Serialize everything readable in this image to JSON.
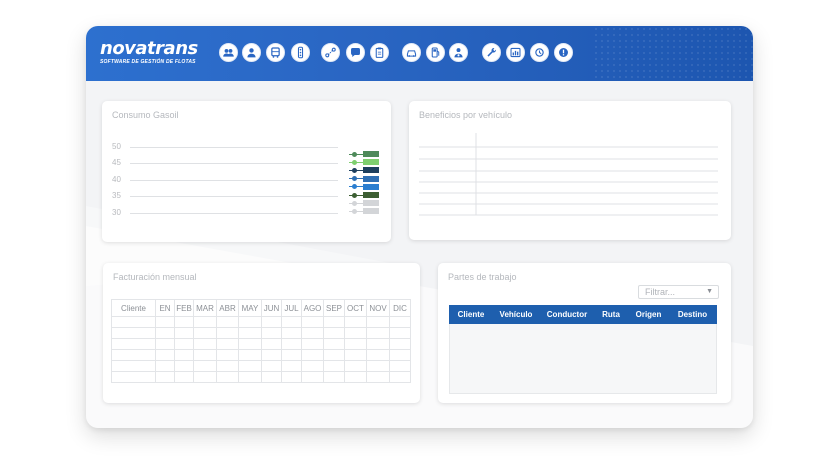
{
  "logo": {
    "name": "novatrans",
    "tagline": "SOFTWARE DE GESTIÓN DE FLOTAS"
  },
  "toolbar": {
    "icons": [
      "users-icon",
      "user-icon",
      "bus-icon",
      "traffic-light-icon",
      "route-icon",
      "chat-icon",
      "clipboard-icon",
      "car-icon",
      "fuel-icon",
      "driver-icon",
      "wrench-icon",
      "report-icon",
      "service-icon",
      "alert-icon"
    ]
  },
  "consumo": {
    "title": "Consumo Gasoil",
    "yticks": [
      "50",
      "45",
      "40",
      "35",
      "30"
    ],
    "legend_colors": [
      "#4e8a5a",
      "#7fcf6f",
      "#1d3f5e",
      "#2f6fb3",
      "#2b7ed0",
      "#3d5f33",
      "#d3d5d8",
      "#d3d5d8"
    ]
  },
  "beneficios": {
    "title": "Beneficios por vehículo"
  },
  "facturacion": {
    "title": "Facturación mensual",
    "columns": [
      "Cliente",
      "EN",
      "FEB",
      "MAR",
      "ABR",
      "MAY",
      "JUN",
      "JUL",
      "AGO",
      "SEP",
      "OCT",
      "NOV",
      "DIC"
    ]
  },
  "partes": {
    "title": "Partes de trabajo",
    "filter_placeholder": "Filtrar...",
    "columns": [
      "Cliente",
      "Vehículo",
      "Conductor",
      "Ruta",
      "Origen",
      "Destino"
    ]
  },
  "colors": {
    "header_blue": "#2a66c3",
    "table_head": "#1e5fae"
  }
}
